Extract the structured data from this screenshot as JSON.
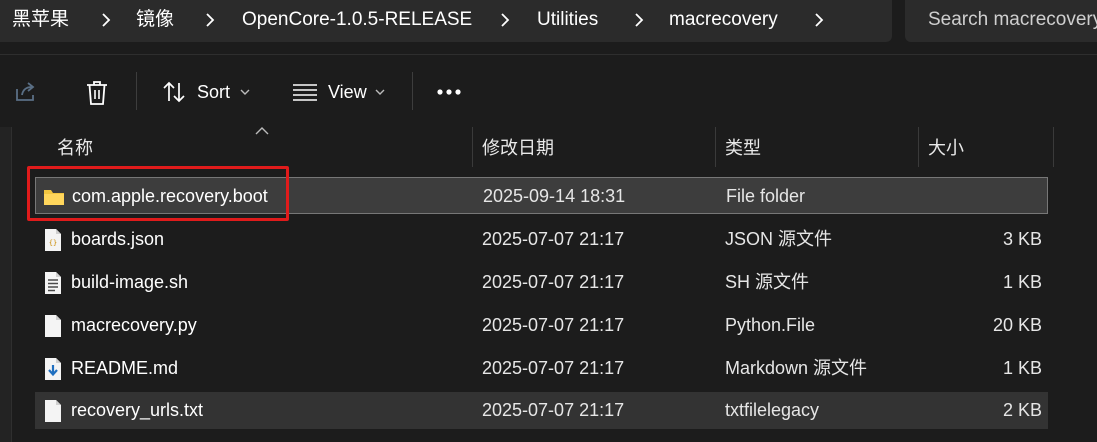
{
  "breadcrumb": {
    "items": [
      "黑苹果",
      "镜像",
      "OpenCore-1.0.5-RELEASE",
      "Utilities",
      "macrecovery"
    ]
  },
  "search": {
    "placeholder": "Search macrecovery"
  },
  "toolbar": {
    "sort_label": "Sort",
    "view_label": "View"
  },
  "columns": {
    "name": "名称",
    "date": "修改日期",
    "type": "类型",
    "size": "大小"
  },
  "files": [
    {
      "name": "com.apple.recovery.boot",
      "date": "2025-09-14 18:31",
      "type": "File folder",
      "size": "",
      "icon": "folder-icon"
    },
    {
      "name": "boards.json",
      "date": "2025-07-07 21:17",
      "type": "JSON 源文件",
      "size": "3 KB",
      "icon": "json-file-icon"
    },
    {
      "name": "build-image.sh",
      "date": "2025-07-07 21:17",
      "type": "SH 源文件",
      "size": "1 KB",
      "icon": "script-file-icon"
    },
    {
      "name": "macrecovery.py",
      "date": "2025-07-07 21:17",
      "type": "Python.File",
      "size": "20 KB",
      "icon": "file-icon"
    },
    {
      "name": "README.md",
      "date": "2025-07-07 21:17",
      "type": "Markdown 源文件",
      "size": "1 KB",
      "icon": "markdown-file-icon"
    },
    {
      "name": "recovery_urls.txt",
      "date": "2025-07-07 21:17",
      "type": "txtfilelegacy",
      "size": "2 KB",
      "icon": "file-icon"
    }
  ],
  "colors": {
    "highlight": "#e01b1b",
    "folder": "#f3c640"
  }
}
